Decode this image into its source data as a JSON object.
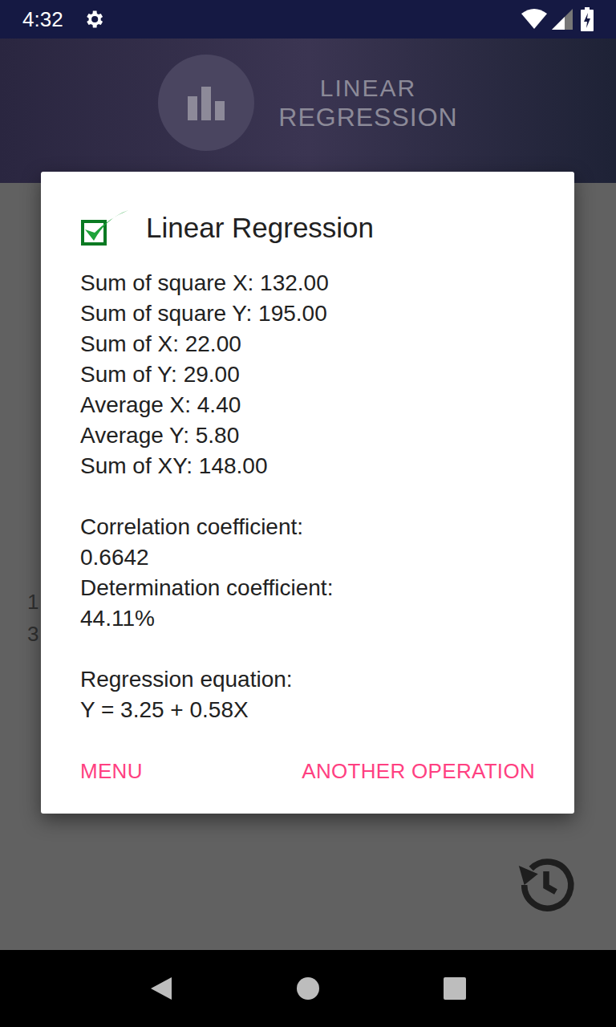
{
  "status_bar": {
    "time": "4:32"
  },
  "header": {
    "logo_lines": [
      "LINEAR",
      "REGRESSION"
    ]
  },
  "background_rows": [
    "1",
    "3"
  ],
  "dialog": {
    "title": "Linear Regression",
    "stats": [
      "Sum of square X: 132.00",
      "Sum of square Y: 195.00",
      "Sum of X: 22.00",
      "Sum of Y: 29.00",
      "Average X: 4.40",
      "Average Y: 5.80",
      "Sum of XY: 148.00"
    ],
    "coefficients": [
      {
        "label": "Correlation coefficient:",
        "value": "0.6642"
      },
      {
        "label": "Determination coefficient:",
        "value": "44.11%"
      }
    ],
    "equation": {
      "label": "Regression equation:",
      "value": "Y = 3.25 + 0.58X"
    },
    "buttons": [
      "MENU",
      "ANOTHER OPERATION"
    ]
  }
}
